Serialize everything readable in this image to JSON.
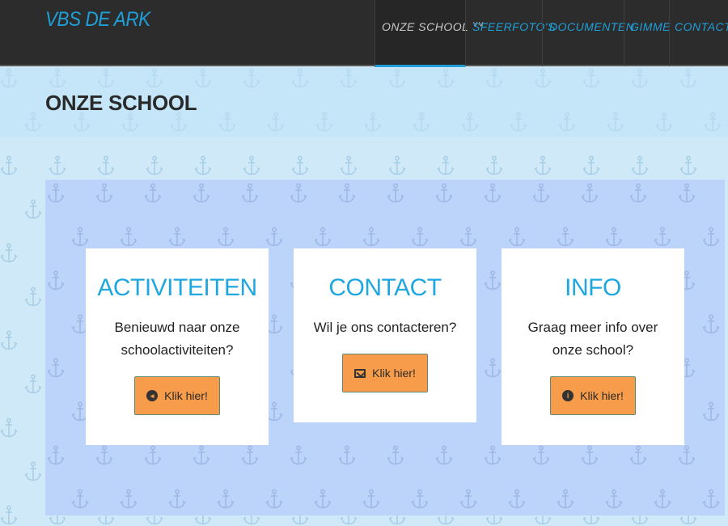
{
  "brand": {
    "name": "VBS DE ARK"
  },
  "nav": {
    "items": [
      {
        "label": "ONZE SCHOOL",
        "active": true
      },
      {
        "label": "SFEERFOTO'S"
      },
      {
        "label": "DOCUMENTEN"
      },
      {
        "label": "GIMME"
      },
      {
        "label": "CONTACT"
      }
    ]
  },
  "page": {
    "title": "ONZE SCHOOL"
  },
  "cards": [
    {
      "title": "ACTIVITEITEN",
      "text": "Benieuwd naar onze schoolactiviteiten?",
      "button": "Klik hier!",
      "icon": "arrow-circle-icon"
    },
    {
      "title": "CONTACT",
      "text": "Wil je ons contacteren?",
      "button": "Klik hier!",
      "icon": "envelope-icon"
    },
    {
      "title": "INFO",
      "text": "Graag meer info over onze school?",
      "button": "Klik hier!",
      "icon": "info-circle-icon"
    }
  ],
  "colors": {
    "accent": "#1fa7df",
    "navbar": "#2c2c2c",
    "button": "#f79c4a",
    "panel": "#bcd4f9",
    "background": "#cfe9f9"
  }
}
